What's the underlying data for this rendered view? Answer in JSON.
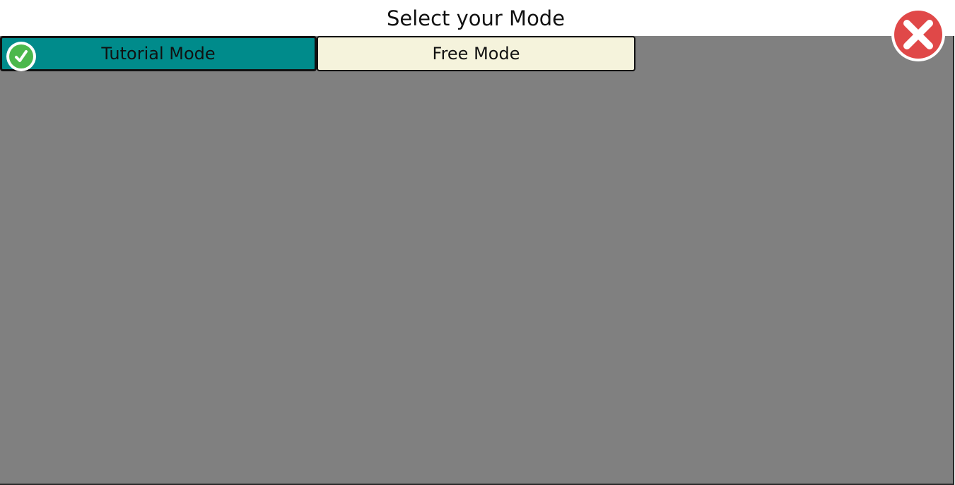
{
  "header": {
    "title": "Select your Mode"
  },
  "tabs": [
    {
      "label": "Tutorial Mode",
      "selected": true,
      "color": "#008b8b",
      "icon": "checkmark-icon"
    },
    {
      "label": "Free Mode",
      "selected": false,
      "color": "#f5f3dc"
    }
  ],
  "close_button": {
    "icon": "close-icon",
    "color": "#e04848"
  },
  "content": {
    "background": "#808080"
  }
}
